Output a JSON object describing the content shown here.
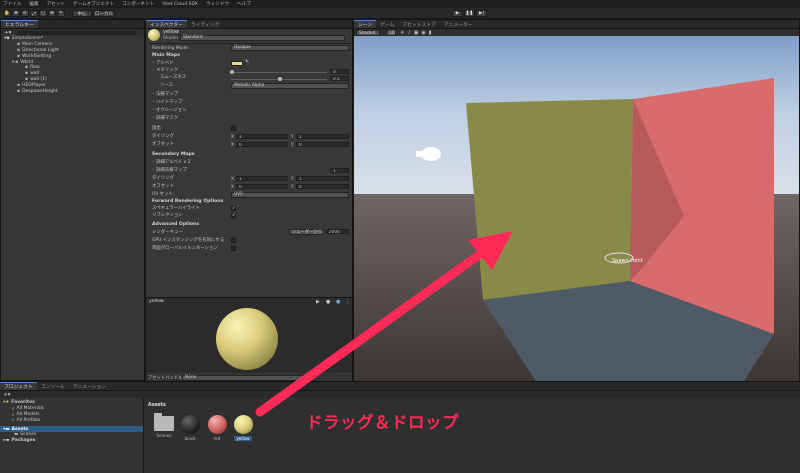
{
  "menu": [
    "ファイル",
    "編集",
    "アセット",
    "ゲームオブジェクト",
    "コンポーネント",
    "Vket Cloud SDK",
    "ウィンドウ",
    "ヘルプ"
  ],
  "toolbar": {
    "center": "中心",
    "local": "ローカル"
  },
  "hierarchy": {
    "tab": "ヒエラルキー",
    "scene": "SimpleScene*",
    "items": [
      "Main Camera",
      "Directional Light",
      "WorldSetting",
      "World",
      "floor",
      "wall",
      "wall (1)",
      "HEOPlayer",
      "DespawnHeight"
    ]
  },
  "inspector": {
    "tabs": [
      "インスペクター",
      "ライティング"
    ],
    "material_name": "yellow",
    "shader_label": "Shader",
    "shader_value": "Standard",
    "rendering_mode_label": "Rendering Mode",
    "rendering_mode_value": "Opaque",
    "main_maps": "Main Maps",
    "albedo": "アルベド",
    "metallic": "メタリック",
    "metallic_value": "0",
    "smoothness": "スムーズネス",
    "smoothness_value": "0.5",
    "source": "ソース",
    "source_value": "Metallic Alpha",
    "normal_map": "法線マップ",
    "height_map": "ハイトマップ",
    "occlusion": "オクルージョン",
    "detail_mask": "詳細マスク",
    "emission": "放出",
    "tiling": "タイリング",
    "offset": "オフセット",
    "tiling_x": "1",
    "tiling_y": "1",
    "offset_x": "0",
    "offset_y": "0",
    "secondary_maps": "Secondary Maps",
    "detail_albedo": "詳細アルベド x 2",
    "detail_normal": "詳細法線マップ",
    "detail_normal_value": "1",
    "tiling2_x": "1",
    "tiling2_y": "1",
    "offset2_x": "0",
    "offset2_y": "0",
    "uv_set": "UV セット",
    "uv_set_value": "UV0",
    "forward_options": "Forward Rendering Options",
    "specular_highlights": "スペキュラーハイライト",
    "reflections": "リフレクション",
    "advanced": "Advanced Options",
    "render_queue": "レンダーキュー",
    "render_queue_mode": "シェーダーから",
    "render_queue_value": "2000",
    "gpu_instancing": "GPU インスタンシングを有効にする",
    "double_sided_gi": "両面グローバルイルミネーション",
    "preview_name": "yellow",
    "asset_bundle_label": "アセットバンドル",
    "asset_bundle_value": "None"
  },
  "scene_view": {
    "tabs": [
      "シーン",
      "ゲーム",
      "アセットストア",
      "アニメーター"
    ],
    "shading": "Shaded",
    "mode_2d": "2D",
    "spawn_label": "Spawn Point"
  },
  "project": {
    "tabs": [
      "プロジェクト",
      "コンソール",
      "アニメーション"
    ],
    "favorites": "Favorites",
    "fav_items": [
      "All Materials",
      "All Models",
      "All Prefabs"
    ],
    "assets_root": "Assets",
    "scenes_folder": "Scenes",
    "packages": "Packages",
    "assets_header": "Assets",
    "asset_items": [
      "Scenes",
      "black",
      "red",
      "yellow"
    ]
  },
  "annotation": {
    "text": "ドラッグ＆ドロップ"
  },
  "colors": {
    "annotation": "#ff2a55",
    "yellow": "#e6dc8c",
    "wall_red": "#d86c6c",
    "wall_olive": "#8a8a4a",
    "sky": "#b8c8de",
    "selection": "#2c5d87"
  }
}
